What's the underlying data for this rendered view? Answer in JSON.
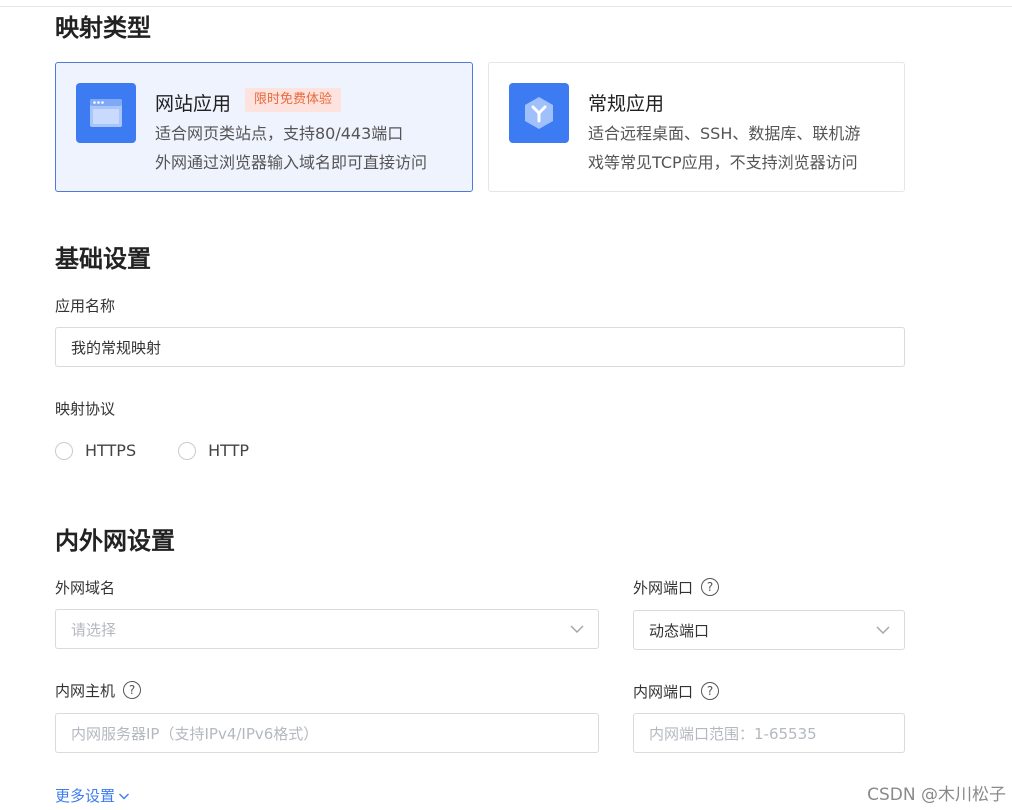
{
  "sections": {
    "mapping_type": "映射类型",
    "basic": "基础设置",
    "network": "内外网设置"
  },
  "cards": [
    {
      "title": "网站应用",
      "badge": "限时免费体验",
      "line1": "适合网页类站点，支持80/443端口",
      "line2": "外网通过浏览器输入域名即可直接访问",
      "icon": "browser-window-icon",
      "selected": true
    },
    {
      "title": "常规应用",
      "line1": "适合远程桌面、SSH、数据库、联机游",
      "line2": "戏等常见TCP应用，不支持浏览器访问",
      "icon": "hexagon-y-icon",
      "selected": false
    }
  ],
  "app_name": {
    "label": "应用名称",
    "value": "我的常规映射"
  },
  "protocol": {
    "label": "映射协议",
    "options": [
      "HTTPS",
      "HTTP"
    ]
  },
  "external_domain": {
    "label": "外网域名",
    "placeholder": "请选择"
  },
  "external_port": {
    "label": "外网端口",
    "value": "动态端口"
  },
  "internal_host": {
    "label": "内网主机",
    "placeholder": "内网服务器IP（支持IPv4/IPv6格式）"
  },
  "internal_port": {
    "label": "内网端口",
    "placeholder": "内网端口范围：1-65535"
  },
  "more_settings": "更多设置",
  "watermark": "CSDN @木川松子",
  "colors": {
    "accent": "#3d7bf2",
    "badge_bg": "#fde2dd",
    "badge_text": "#e86a3c",
    "selected_bg": "#eef3fd"
  }
}
